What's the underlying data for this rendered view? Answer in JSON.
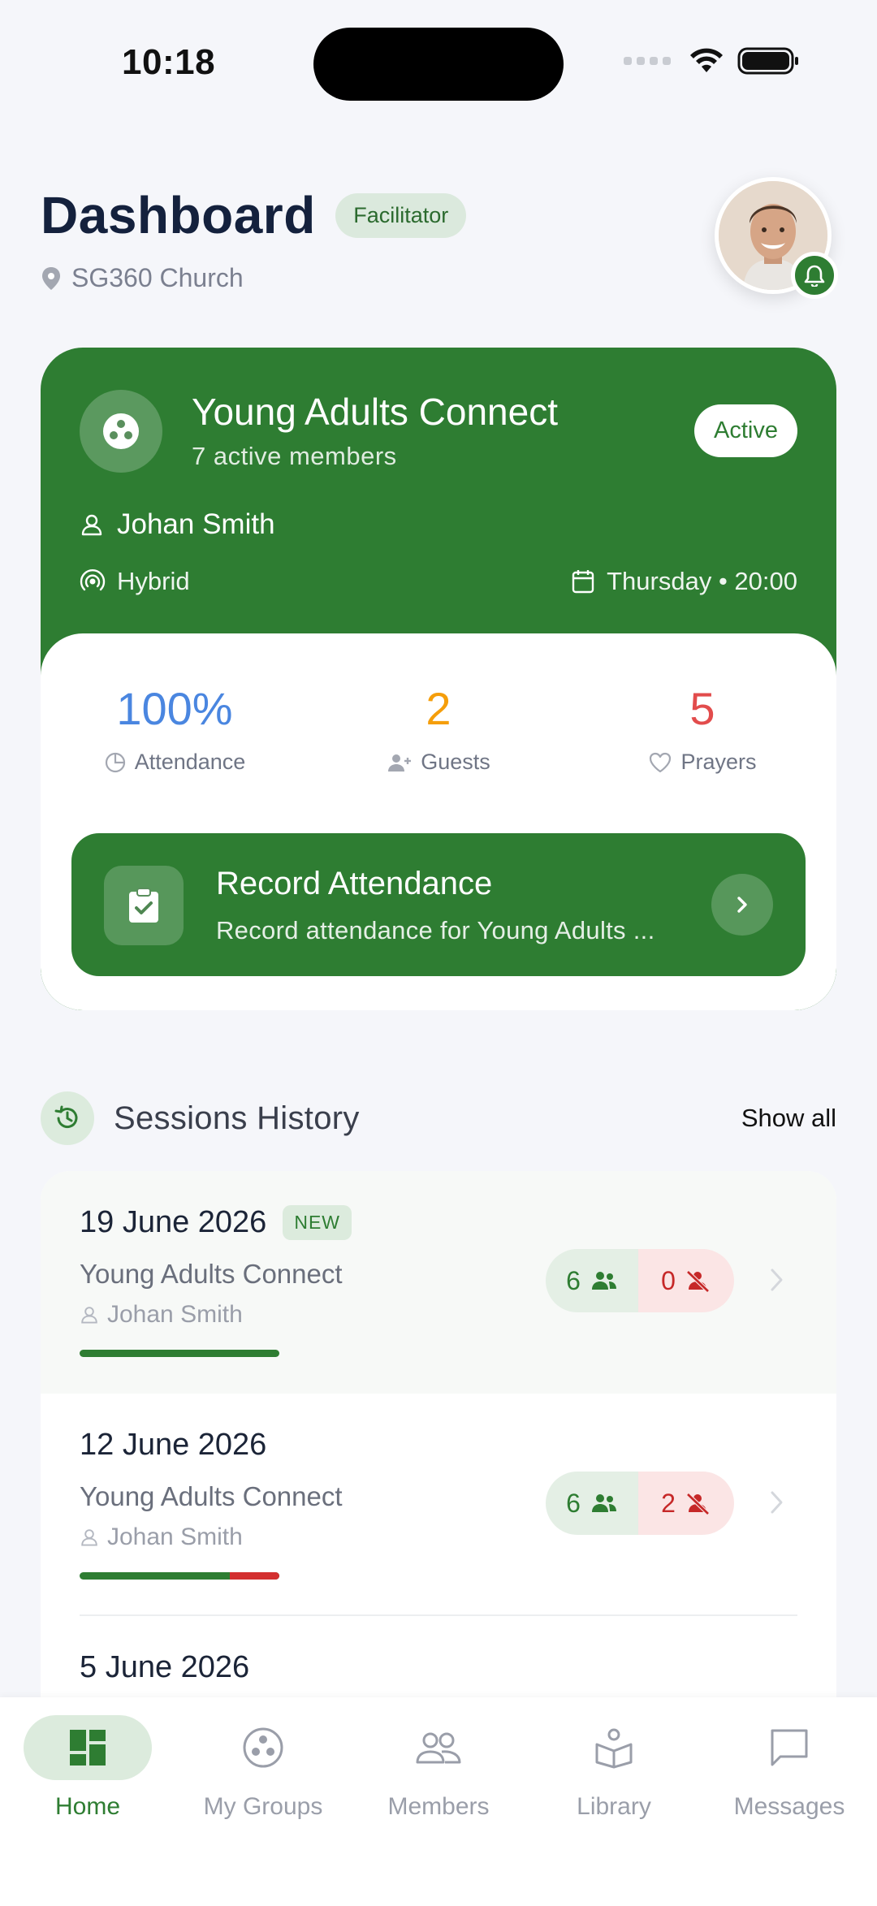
{
  "status_bar": {
    "time": "10:18"
  },
  "header": {
    "title": "Dashboard",
    "role_badge": "Facilitator",
    "location": "SG360 Church"
  },
  "group_card": {
    "name": "Young Adults Connect",
    "members": "7 active members",
    "status": "Active",
    "leader": "Johan Smith",
    "mode": "Hybrid",
    "schedule": "Thursday • 20:00",
    "stats": [
      {
        "value": "100%",
        "label": "Attendance",
        "color": "#4a86e0"
      },
      {
        "value": "2",
        "label": "Guests",
        "color": "#f59e0b"
      },
      {
        "value": "5",
        "label": "Prayers",
        "color": "#e24c4c"
      }
    ],
    "record": {
      "title": "Record Attendance",
      "subtitle": "Record attendance for Young Adults ..."
    }
  },
  "sessions": {
    "title": "Sessions History",
    "show_all": "Show all",
    "items": [
      {
        "date": "19 June 2026",
        "badge": "NEW",
        "group": "Young Adults Connect",
        "leader": "Johan Smith",
        "present": "6",
        "absent": "0",
        "attendance_fraction": 1.0
      },
      {
        "date": "12 June 2026",
        "badge": "",
        "group": "Young Adults Connect",
        "leader": "Johan Smith",
        "present": "6",
        "absent": "2",
        "attendance_fraction": 0.75
      },
      {
        "date": "5 June 2026",
        "badge": "",
        "group": "",
        "leader": "",
        "present": "",
        "absent": "",
        "attendance_fraction": 0
      }
    ]
  },
  "tabs": [
    {
      "label": "Home",
      "icon": "dashboard-icon",
      "active": true
    },
    {
      "label": "My Groups",
      "icon": "groups-icon",
      "active": false
    },
    {
      "label": "Members",
      "icon": "members-icon",
      "active": false
    },
    {
      "label": "Library",
      "icon": "library-icon",
      "active": false
    },
    {
      "label": "Messages",
      "icon": "messages-icon",
      "active": false
    }
  ],
  "colors": {
    "brand_green": "#2e7d32",
    "absent_red": "#d32f2f"
  }
}
